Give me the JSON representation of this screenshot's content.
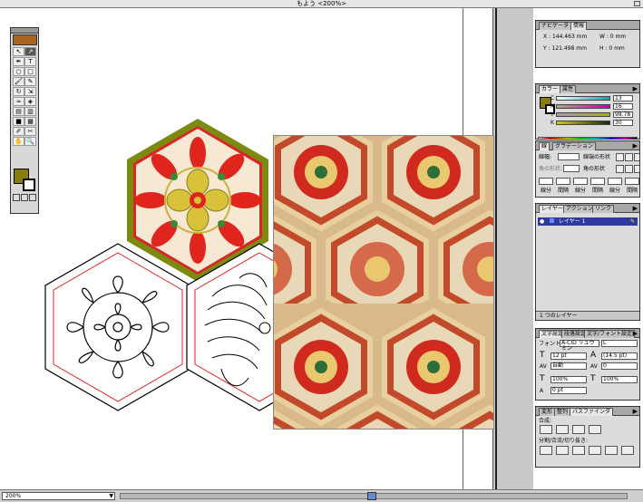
{
  "window": {
    "title": "もよう <200%>"
  },
  "status": {
    "zoom": "200%"
  },
  "toolbox": {
    "tools": [
      "select-arrow",
      "direct-select",
      "pen",
      "type",
      "ellipse",
      "rectangle",
      "brush",
      "pencil",
      "rotate",
      "scale",
      "warp",
      "blend",
      "graph",
      "column-graph",
      "gradient",
      "mesh",
      "eyedropper",
      "scissors",
      "hand",
      "zoom"
    ]
  },
  "colors": {
    "fill": "#8a7d10",
    "accent_row": "#2e3aa0"
  },
  "panels": {
    "navigator": {
      "tabs": [
        "ナビゲータ",
        "情報"
      ],
      "x": "X : 144.463 mm",
      "y": "Y : 121.498 mm",
      "w": "W : 0 mm",
      "h": "H : 0 mm"
    },
    "color": {
      "tabs": [
        "カラー",
        "属性"
      ],
      "channels": [
        {
          "label": "C",
          "value": "13"
        },
        {
          "label": "M",
          "value": "16"
        },
        {
          "label": "Y",
          "value": "98.78"
        },
        {
          "label": "K",
          "value": "30"
        }
      ]
    },
    "align": {
      "tabs": [
        "線",
        "グラデーション"
      ],
      "row1_label": "線幅:",
      "row1_suffix": "線端の形状",
      "row2_label": "角の形状:",
      "row2_suffix": "角の形状",
      "bottom_labels": [
        "線分",
        "間隔",
        "線分",
        "間隔",
        "線分",
        "間隔"
      ]
    },
    "layers": {
      "tabs": [
        "レイヤー",
        "アクション",
        "リンク"
      ],
      "layer_name": "レイヤー 1",
      "footer": "1 つのレイヤー"
    },
    "character": {
      "tabs": [
        "文字設定",
        "段落設定",
        "文字/フォント設定"
      ],
      "font_label": "フォント:",
      "font_value": "A-CID リュウミン",
      "font_style": "L",
      "size": "12 pt",
      "leading": "(14.5 pt)",
      "tracking_mode": "自動",
      "tracking": "0",
      "vscale": "100%",
      "hscale": "100%",
      "baseline": "0 pt"
    },
    "pathfinder": {
      "tabs": [
        "変形",
        "整列",
        "パスファインダ"
      ],
      "label1": "合成:",
      "label2": "分割/合流/切り抜き:"
    }
  }
}
